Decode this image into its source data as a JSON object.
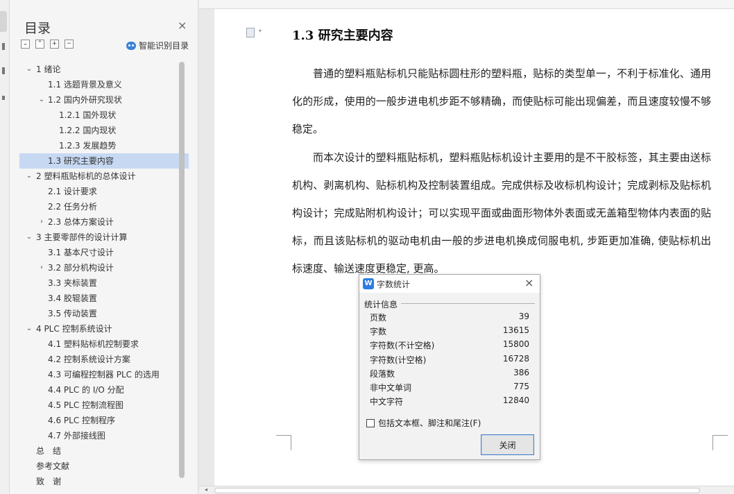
{
  "toc": {
    "title": "目录",
    "close_label": "×",
    "tool_buttons": [
      "⌄",
      "⌃",
      "+",
      "−"
    ],
    "ai_button_label": "智能识别目录",
    "items": [
      {
        "label": "1 绪论",
        "level": 1,
        "arrow": "⌄"
      },
      {
        "label": "1.1 选题背景及意义",
        "level": 2,
        "arrow": ""
      },
      {
        "label": "1.2 国内外研究现状",
        "level": 2,
        "arrow": "⌄"
      },
      {
        "label": "1.2.1 国外现状",
        "level": 3,
        "arrow": ""
      },
      {
        "label": "1.2.2 国内现状",
        "level": 3,
        "arrow": ""
      },
      {
        "label": "1.2.3 发展趋势",
        "level": 3,
        "arrow": ""
      },
      {
        "label": "1.3 研究主要内容",
        "level": 2,
        "arrow": "",
        "selected": true
      },
      {
        "label": "2 塑料瓶贴标机的总体设计",
        "level": 1,
        "arrow": "⌄"
      },
      {
        "label": "2.1 设计要求",
        "level": 2,
        "arrow": ""
      },
      {
        "label": "2.2 任务分析",
        "level": 2,
        "arrow": ""
      },
      {
        "label": "2.3 总体方案设计",
        "level": 2,
        "arrow": "›"
      },
      {
        "label": "3 主要零部件的设计计算",
        "level": 1,
        "arrow": "⌄"
      },
      {
        "label": "3.1 基本尺寸设计",
        "level": 2,
        "arrow": ""
      },
      {
        "label": "3.2 部分机构设计",
        "level": 2,
        "arrow": "›"
      },
      {
        "label": "3.3 夹标装置",
        "level": 2,
        "arrow": ""
      },
      {
        "label": "3.4 胶辊装置",
        "level": 2,
        "arrow": ""
      },
      {
        "label": "3.5 传动装置",
        "level": 2,
        "arrow": ""
      },
      {
        "label": "4 PLC 控制系统设计",
        "level": 1,
        "arrow": "⌄"
      },
      {
        "label": "4.1 塑料贴标机控制要求",
        "level": 2,
        "arrow": ""
      },
      {
        "label": "4.2 控制系统设计方案",
        "level": 2,
        "arrow": ""
      },
      {
        "label": "4.3 可编程控制器 PLC 的选用",
        "level": 2,
        "arrow": ""
      },
      {
        "label": "4.4 PLC 的 I/O 分配",
        "level": 2,
        "arrow": ""
      },
      {
        "label": "4.5 PLC 控制流程图",
        "level": 2,
        "arrow": ""
      },
      {
        "label": "4.6 PLC 控制程序",
        "level": 2,
        "arrow": ""
      },
      {
        "label": "4.7 外部接线图",
        "level": 2,
        "arrow": ""
      },
      {
        "label": "总　结",
        "level": 1,
        "arrow": "",
        "flat": true
      },
      {
        "label": "参考文献",
        "level": 1,
        "arrow": "",
        "flat": true
      },
      {
        "label": "致　谢",
        "level": 1,
        "arrow": "",
        "flat": true
      }
    ]
  },
  "document": {
    "heading": "1.3 研究主要内容",
    "paragraphs": [
      "普通的塑料瓶贴标机只能贴标圆柱形的塑料瓶，贴标的类型单一，不利于标准化、通用化的形成，使用的一般步进电机步距不够精确，而使贴标可能出现偏差，而且速度较慢不够稳定。",
      "而本次设计的塑料瓶贴标机，塑料瓶贴标机设计主要用的是不干胶标签，其主要由送标机构、剥离机构、贴标机构及控制装置组成。完成供标及收标机构设计；完成剥标及贴标机构设计；完成贴附机构设计；可以实现平面或曲面形物体外表面或无盖箱型物体内表面的贴标，而且该贴标机的驱动电机由一般的步进电机换成伺服电机, 步距更加准确, 使贴标机出标速度、输送速度更稳定, 更高。"
    ]
  },
  "dialog": {
    "title": "字数统计",
    "close_label": "×",
    "group_label": "统计信息",
    "stats": [
      {
        "label": "页数",
        "value": "39"
      },
      {
        "label": "字数",
        "value": "13615"
      },
      {
        "label": "字符数(不计空格)",
        "value": "15800"
      },
      {
        "label": "字符数(计空格)",
        "value": "16728"
      },
      {
        "label": "段落数",
        "value": "386"
      },
      {
        "label": "非中文单词",
        "value": "775"
      },
      {
        "label": "中文字符",
        "value": "12840"
      }
    ],
    "checkbox_label": "包括文本框、脚注和尾注(F)",
    "checkbox_checked": false,
    "close_button_label": "关闭"
  }
}
